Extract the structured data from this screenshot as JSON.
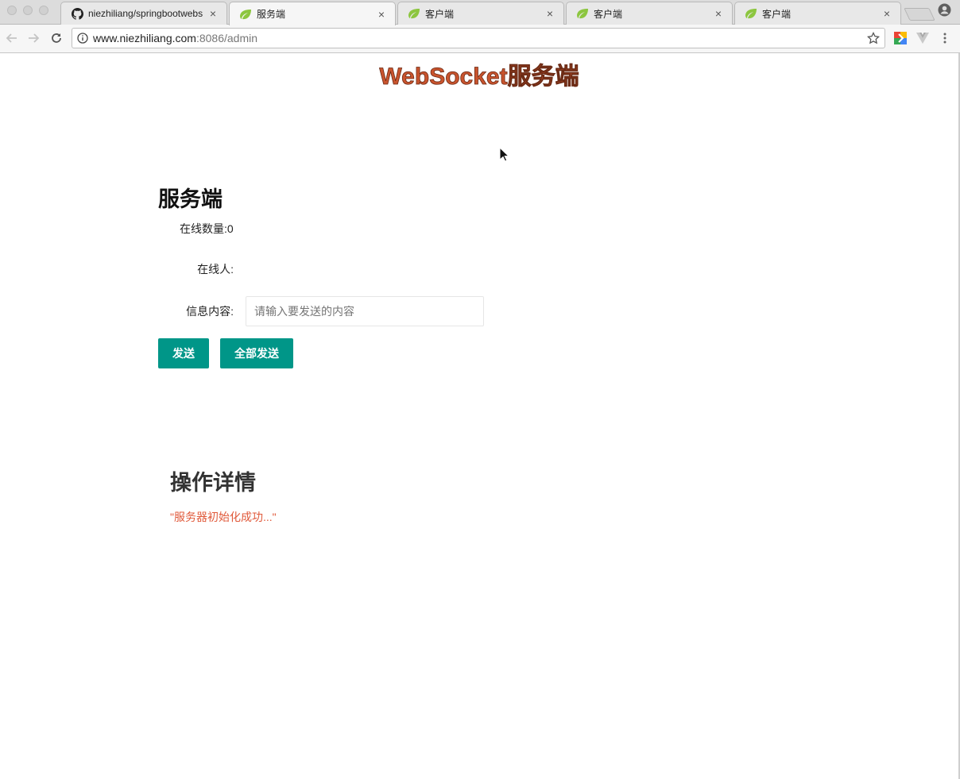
{
  "browser": {
    "tabs": [
      {
        "title": "niezhiliang/springbootwebs",
        "favicon": "github-icon",
        "active": false
      },
      {
        "title": "服务端",
        "favicon": "spring-leaf-icon",
        "active": true
      },
      {
        "title": "客户端",
        "favicon": "spring-leaf-icon",
        "active": false
      },
      {
        "title": "客户端",
        "favicon": "spring-leaf-icon",
        "active": false
      },
      {
        "title": "客户端",
        "favicon": "spring-leaf-icon",
        "active": false
      }
    ],
    "close_glyph": "×",
    "url_host": "www.niezhiliang.com",
    "url_rest": ":8086/admin"
  },
  "page": {
    "banner": "WebSocket服务端",
    "section_title": "服务端",
    "online_count_label": "在线数量:0",
    "online_users_label": "在线人:",
    "message_label": "信息内容:",
    "message_placeholder": "请输入要发送的内容",
    "message_value": "",
    "send_button": "发送",
    "send_all_button": "全部发送",
    "details_title": "操作详情",
    "log_lines": [
      "\"服务器初始化成功...\""
    ]
  },
  "colors": {
    "banner_fill": "#c9542e",
    "button_bg": "#009688",
    "log_text": "#e0593a"
  }
}
